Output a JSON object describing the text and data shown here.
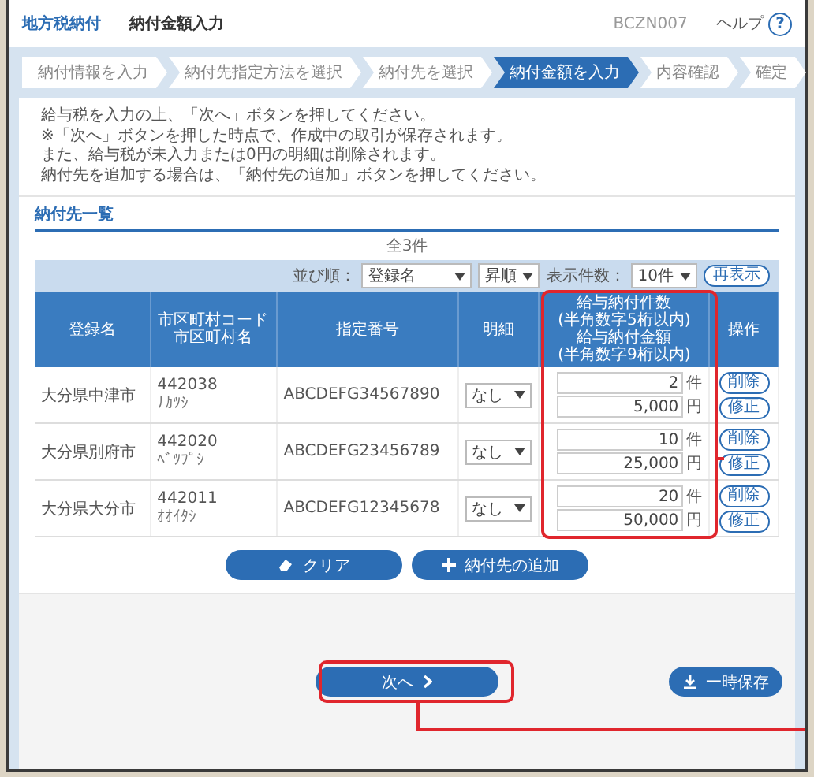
{
  "header": {
    "app_title": "地方税納付",
    "page_title": "納付金額入力",
    "screen_id": "BCZN007",
    "help_label": "ヘルプ",
    "help_icon": "?"
  },
  "steps": [
    {
      "label": "納付情報を入力",
      "selected": false
    },
    {
      "label": "納付先指定方法を選択",
      "selected": false
    },
    {
      "label": "納付先を選択",
      "selected": false
    },
    {
      "label": "納付金額を入力",
      "selected": true
    },
    {
      "label": "内容確認",
      "selected": false
    },
    {
      "label": "確定",
      "selected": false
    }
  ],
  "instructions": [
    "給与税を入力の上、「次へ」ボタンを押してください。",
    "※「次へ」ボタンを押した時点で、作成中の取引が保存されます。",
    "また、給与税が未入力または0円の明細は削除されます。",
    "納付先を追加する場合は、「納付先の追加」ボタンを押してください。"
  ],
  "section_title": "納付先一覧",
  "total": "全3件",
  "sort": {
    "label": "並び順：",
    "field": "登録名",
    "order": "昇順",
    "count_label": "表示件数：",
    "count": "10件",
    "refresh": "再表示"
  },
  "columns": [
    [
      "登録名"
    ],
    [
      "市区町村コード",
      "市区町村名"
    ],
    [
      "指定番号"
    ],
    [
      "明細"
    ],
    [
      "給与納付件数",
      "(半角数字5桁以内)",
      "給与納付金額",
      "(半角数字9桁以内)"
    ],
    [
      "操作"
    ]
  ],
  "rows": [
    {
      "name": "大分県中津市",
      "code": "442038",
      "city": "ﾅｶﾂｼ",
      "number": "ABCDEFG34567890",
      "detail": "なし",
      "count": "2",
      "count_unit": "件",
      "amount": "5,000",
      "amount_unit": "円",
      "actions": [
        "削除",
        "修正"
      ]
    },
    {
      "name": "大分県別府市",
      "code": "442020",
      "city": "ﾍﾞﾂﾌﾟｼ",
      "number": "ABCDEFG23456789",
      "detail": "なし",
      "count": "10",
      "count_unit": "件",
      "amount": "25,000",
      "amount_unit": "円",
      "actions": [
        "削除",
        "修正"
      ]
    },
    {
      "name": "大分県大分市",
      "code": "442011",
      "city": "ｵｵｲﾀｼ",
      "number": "ABCDEFG12345678",
      "detail": "なし",
      "count": "20",
      "count_unit": "件",
      "amount": "50,000",
      "amount_unit": "円",
      "actions": [
        "削除",
        "修正"
      ]
    }
  ],
  "table_buttons": {
    "clear": "クリア",
    "add": "納付先の追加"
  },
  "footer": {
    "next": "次へ",
    "save": "一時保存"
  },
  "highlights": {
    "amount_column": true,
    "next_button": true
  }
}
